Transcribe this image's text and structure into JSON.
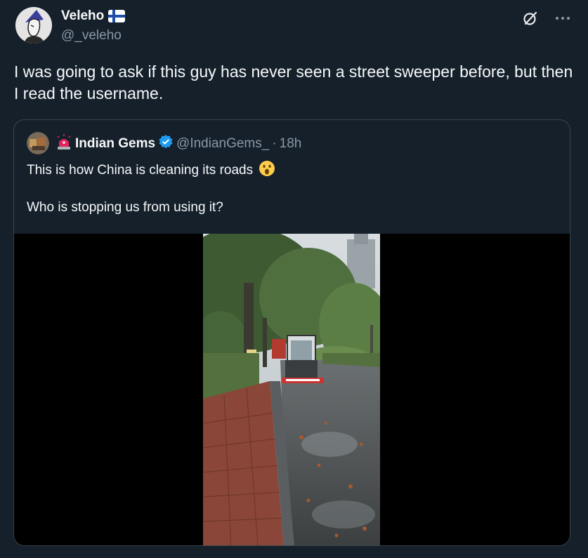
{
  "author": {
    "name": "Veleho",
    "handle": "@_veleho",
    "flag_icon": "finland-flag-icon"
  },
  "tweet": {
    "text": "I was going to ask if this guy has never seen a street sweeper before, but then I read the username."
  },
  "actions": {
    "grok_icon": "grok-icon",
    "more_icon": "more-icon"
  },
  "quoted": {
    "name_prefix_icon": "rotating-light-icon",
    "name": "Indian Gems",
    "verified_icon": "verified-badge-icon",
    "handle": "@IndianGems_",
    "dot": "·",
    "time": "18h",
    "line1": "This is how China is cleaning its roads",
    "line1_emoji": "astonished-face-icon",
    "line2": "Who is stopping us from using it?"
  },
  "colors": {
    "background": "#15202b",
    "text_primary": "#f7f9f9",
    "text_secondary": "#8b98a5",
    "border": "#38444d",
    "verified_blue": "#1d9bf0"
  }
}
